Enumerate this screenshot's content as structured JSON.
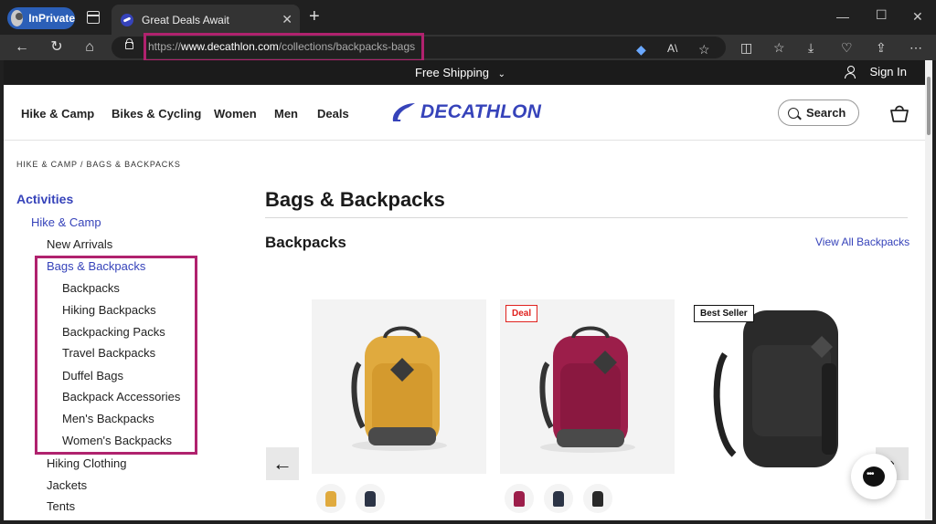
{
  "browser": {
    "inprivate_label": "InPrivate",
    "tab_title": "Great Deals Await",
    "url_prefix": "https://",
    "url_domain": "www.decathlon.com",
    "url_path": "/collections/backpacks-bags",
    "icons": [
      "profile-avatar-icon",
      "tab-actions-icon",
      "favicon-icon",
      "tab-close-icon",
      "new-tab-icon",
      "minimize-icon",
      "maximize-icon",
      "close-window-icon",
      "back-icon",
      "refresh-icon",
      "home-icon",
      "lock-icon",
      "tag-icon",
      "read-aloud-icon",
      "favorite-icon",
      "split-screen-icon",
      "favorites-icon",
      "downloads-icon",
      "browser-essentials-icon",
      "share-icon",
      "more-icon"
    ]
  },
  "promo": {
    "shipping": "Free Shipping",
    "sign_in": "Sign In"
  },
  "nav": {
    "items": [
      "Hike & Camp",
      "Bikes & Cycling",
      "Women",
      "Men",
      "Deals"
    ],
    "logo_text": "DECATHLON",
    "search_label": "Search"
  },
  "breadcrumb": "HIKE & CAMP  /  BAGS & BACKPACKS",
  "sidebar": {
    "activities": "Activities",
    "hike_camp": "Hike & Camp",
    "new_arrivals": "New Arrivals",
    "bags_backpacks": "Bags & Backpacks",
    "sub": [
      "Backpacks",
      "Hiking Backpacks",
      "Backpacking Packs",
      "Travel Backpacks",
      "Duffel Bags",
      "Backpack Accessories",
      "Men's Backpacks",
      "Women's Backpacks"
    ],
    "after": [
      "Hiking Clothing",
      "Jackets",
      "Tents"
    ]
  },
  "main": {
    "title": "Bags & Backpacks",
    "section": "Backpacks",
    "view_all": "View All Backpacks",
    "badges": {
      "deal": "Deal",
      "best_seller": "Best Seller"
    }
  },
  "colors": {
    "brand": "#3643ba",
    "highlight": "#b0226e",
    "deal": "#e0221e",
    "bag_yellow": "#e0aa3e",
    "bag_burgundy": "#9c1e4a",
    "bag_black": "#2a2a2a",
    "bag_navy": "#2c3446"
  }
}
